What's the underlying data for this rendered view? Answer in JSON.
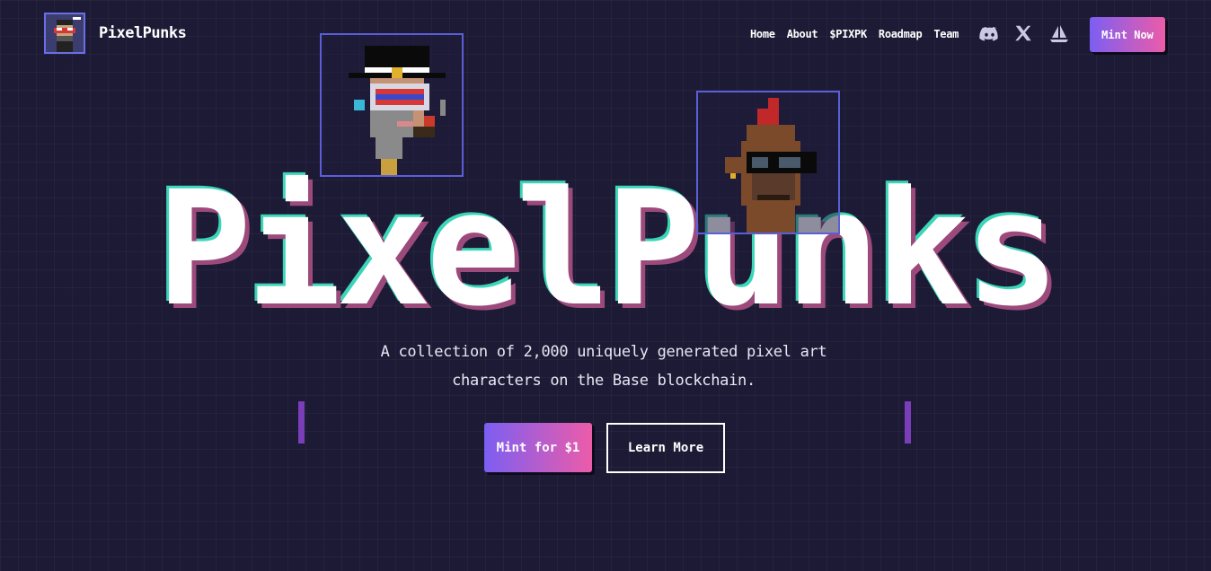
{
  "brand": {
    "name": "PixelPunks",
    "logo_icon": "pixel-punk-avatar-icon"
  },
  "nav": {
    "links": [
      {
        "label": "Home"
      },
      {
        "label": "About"
      },
      {
        "label": "$PIXPK"
      },
      {
        "label": "Roadmap"
      },
      {
        "label": "Team"
      }
    ],
    "social": [
      {
        "icon": "discord-icon"
      },
      {
        "icon": "x-twitter-icon"
      },
      {
        "icon": "opensea-boat-icon"
      }
    ],
    "mint_now_label": "Mint Now"
  },
  "hero": {
    "title": "PixelPunks",
    "tagline_line1": "A collection of 2,000 uniquely generated pixel art",
    "tagline_line2": "characters on the Base blockchain.",
    "mint_button_label": "Mint for $1",
    "learn_button_label": "Learn More"
  },
  "colors": {
    "background": "#1d1a35",
    "accent_gradient_start": "#7c5ef2",
    "accent_gradient_end": "#ec5ca9",
    "card_border": "#5b5fd6",
    "side_bar": "#7a3fb8"
  }
}
